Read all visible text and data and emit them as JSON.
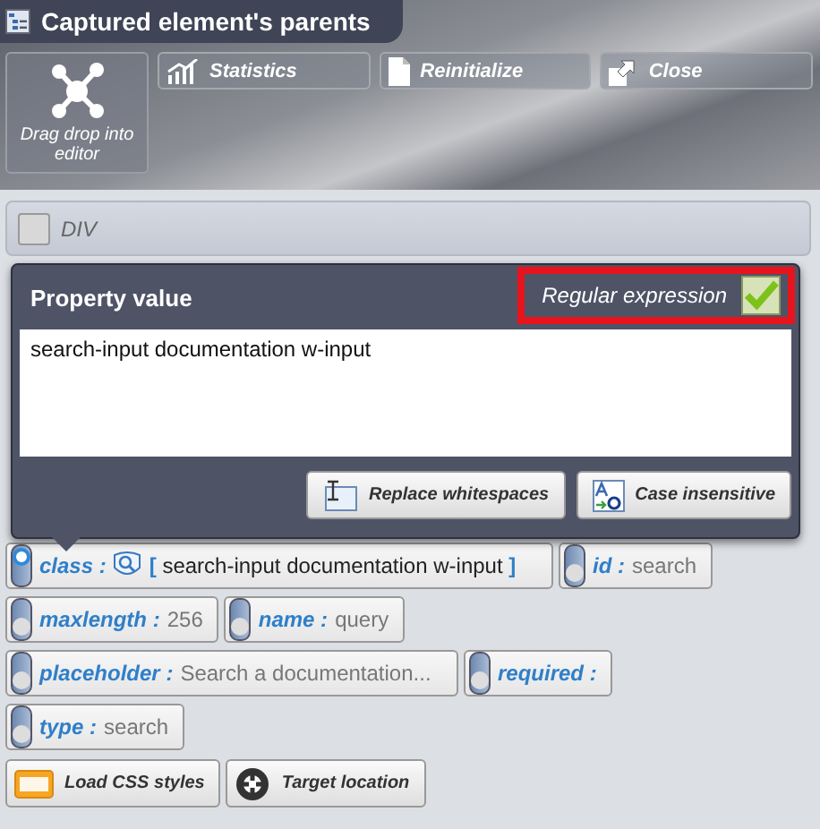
{
  "window": {
    "title": "Captured element's parents"
  },
  "toolbar": {
    "drag_tile": {
      "label": "Drag drop into editor"
    },
    "buttons": [
      {
        "kind": "statistics",
        "label": "Statistics"
      },
      {
        "kind": "reinitialize",
        "label": "Reinitialize"
      },
      {
        "kind": "close",
        "label": "Close"
      }
    ]
  },
  "parents": [
    {
      "label": "DIV"
    }
  ],
  "property_popup": {
    "title": "Property value",
    "regular_expression": {
      "label": "Regular expression",
      "checked": true,
      "highlighted": true
    },
    "value": "search-input documentation w-input",
    "buttons": [
      {
        "kind": "whitespace",
        "label": "Replace whitespaces"
      },
      {
        "kind": "case",
        "label": "Case insensitive"
      }
    ]
  },
  "attributes": [
    {
      "name": "class :",
      "open": "[",
      "value": "search-input documentation w-input",
      "close": "]",
      "on": true,
      "kind": "regex"
    },
    {
      "name": "id :",
      "value": "search",
      "on": false,
      "kind": "plain"
    },
    {
      "name": "maxlength :",
      "value": "256",
      "on": false,
      "kind": "plain"
    },
    {
      "name": "name :",
      "value": "query",
      "on": false,
      "kind": "plain"
    },
    {
      "name": "placeholder :",
      "value": "Search a documentation...",
      "on": false,
      "kind": "plain"
    },
    {
      "name": "required :",
      "on": false,
      "kind": "plain"
    },
    {
      "name": "type :",
      "value": "search",
      "on": false,
      "kind": "plain"
    }
  ],
  "bottom_buttons": [
    {
      "kind": "css",
      "label": "Load CSS styles"
    },
    {
      "kind": "target",
      "label": "Target location"
    }
  ]
}
